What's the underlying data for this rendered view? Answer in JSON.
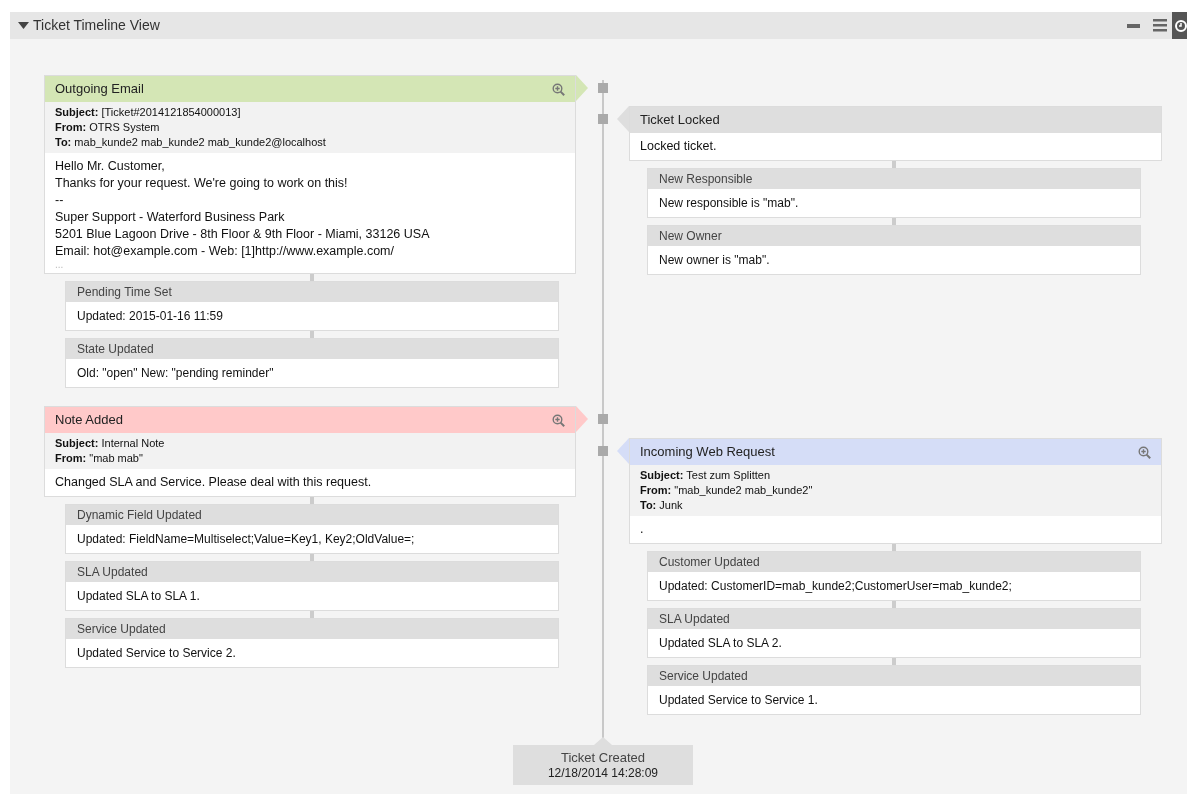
{
  "panel": {
    "title": "Ticket Timeline View",
    "expanded": true
  },
  "left": [
    {
      "kind": "article",
      "title": "Outgoing Email",
      "color": "#d4e6b5",
      "fields": [
        {
          "label": "Subject:",
          "value": "[Ticket#2014121854000013]"
        },
        {
          "label": "From:",
          "value": "OTRS System"
        },
        {
          "label": "To:",
          "value": "mab_kunde2 mab_kunde2 mab_kunde2@localhost"
        }
      ],
      "body": [
        "Hello Mr. Customer,",
        "Thanks for your request. We're going to work on this!",
        "--",
        "Super Support - Waterford Business Park",
        "5201 Blue Lagoon Drive - 8th Floor & 9th Floor - Miami, 33126 USA",
        "Email: hot@example.com - Web: [1]http://www.example.com/"
      ],
      "more": "...",
      "children": [
        {
          "title": "Pending Time Set",
          "text": "Updated: 2015-01-16 11:59"
        },
        {
          "title": "State Updated",
          "text": "Old: \"open\" New: \"pending reminder\""
        }
      ]
    },
    {
      "kind": "article",
      "title": "Note Added",
      "color": "#ffc9c9",
      "fields": [
        {
          "label": "Subject:",
          "value": "Internal Note"
        },
        {
          "label": "From:",
          "value": "\"mab mab\""
        }
      ],
      "body": [
        "Changed SLA and Service. Please deal with this request."
      ],
      "children": [
        {
          "title": "Dynamic Field Updated",
          "text": "Updated: FieldName=Multiselect;Value=Key1, Key2;OldValue=;"
        },
        {
          "title": "SLA Updated",
          "text": "Updated SLA to SLA 1."
        },
        {
          "title": "Service Updated",
          "text": "Updated Service to Service 2."
        }
      ]
    }
  ],
  "right": [
    {
      "kind": "event",
      "title": "Ticket Locked",
      "color": "#dedede",
      "body": [
        "Locked ticket."
      ],
      "children": [
        {
          "title": "New Responsible",
          "text": "New responsible is \"mab\"."
        },
        {
          "title": "New Owner",
          "text": "New owner is \"mab\"."
        }
      ]
    },
    {
      "kind": "article",
      "title": "Incoming Web Request",
      "color": "#d5ddf7",
      "fields": [
        {
          "label": "Subject:",
          "value": "Test zum Splitten"
        },
        {
          "label": "From:",
          "value": "\"mab_kunde2 mab_kunde2\""
        },
        {
          "label": "To:",
          "value": "Junk"
        }
      ],
      "body": [
        "."
      ],
      "children": [
        {
          "title": "Customer Updated",
          "text": "Updated: CustomerID=mab_kunde2;CustomerUser=mab_kunde2;"
        },
        {
          "title": "SLA Updated",
          "text": "Updated SLA to SLA 2."
        },
        {
          "title": "Service Updated",
          "text": "Updated Service to Service 1."
        }
      ]
    }
  ],
  "created": {
    "title": "Ticket Created",
    "time": "12/18/2014 14:28:09"
  }
}
